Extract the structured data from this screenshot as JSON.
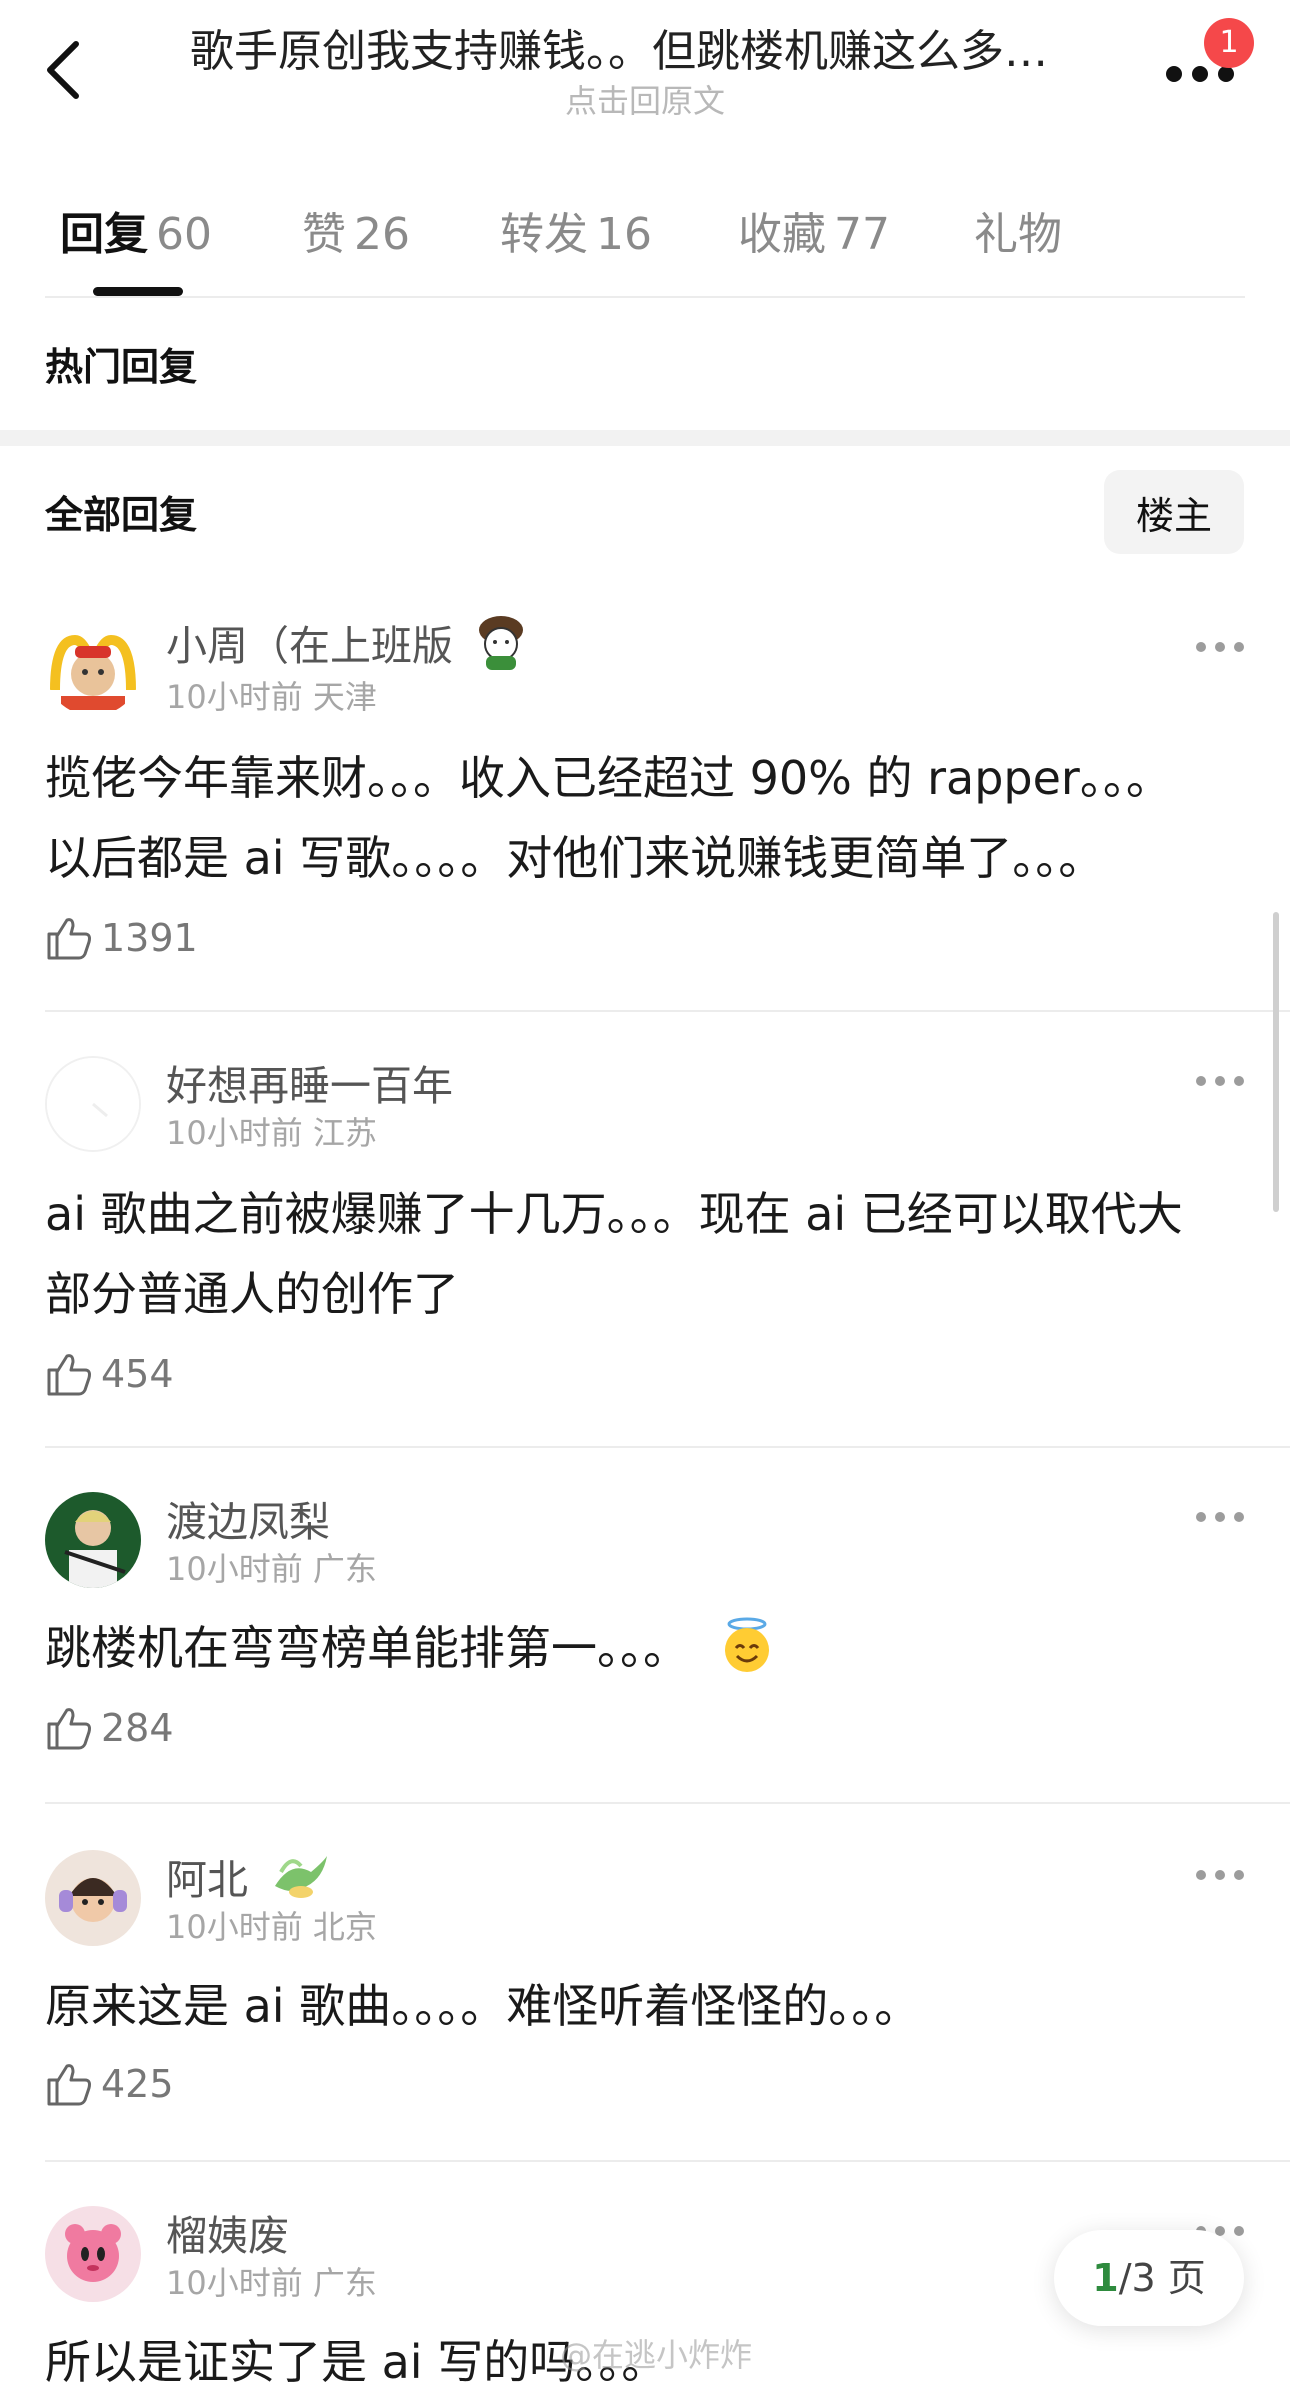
{
  "header": {
    "title": "歌手原创我支持赚钱。。但跳楼机赚这么多…",
    "subtitle": "点击回原文",
    "notification_count": "1"
  },
  "tabs": [
    {
      "label": "回复",
      "count": "60"
    },
    {
      "label": "赞",
      "count": "26"
    },
    {
      "label": "转发",
      "count": "16"
    },
    {
      "label": "收藏",
      "count": "77"
    },
    {
      "label": "礼物",
      "count": ""
    }
  ],
  "sections": {
    "hot_title": "热门回复",
    "all_title": "全部回复",
    "op_filter": "楼主"
  },
  "comments": [
    {
      "user": "小周（在上班版",
      "time": "10小时前",
      "location": "天津",
      "lines": [
        "揽佬今年靠来财。。。收入已经超过 90% 的 rapper。。。",
        "以后都是 ai 写歌。。。。对他们来说赚钱更简单了。。。"
      ],
      "likes": "1391"
    },
    {
      "user": "好想再睡一百年",
      "time": "10小时前",
      "location": "江苏",
      "lines": [
        "ai 歌曲之前被爆赚了十几万。。。现在 ai 已经可以取代大",
        "部分普通人的创作了"
      ],
      "likes": "454"
    },
    {
      "user": "渡边凤梨",
      "time": "10小时前",
      "location": "广东",
      "lines": [
        "跳楼机在弯弯榜单能排第一。。。"
      ],
      "emoji": "😇",
      "likes": "284"
    },
    {
      "user": "阿北",
      "time": "10小时前",
      "location": "北京",
      "lines": [
        "原来这是 ai 歌曲。。。。难怪听着怪怪的。。。"
      ],
      "likes": "425"
    },
    {
      "user": "榴姨废",
      "time": "10小时前",
      "location": "广东",
      "lines": [
        "所以是证实了是 ai 写的吗。。。"
      ],
      "likes": ""
    }
  ],
  "pager": {
    "current": "1",
    "total_text": "/3 页"
  },
  "watermark": "@在逃小炸炸",
  "colors": {
    "badge": "#f5484a",
    "pager_current": "#2e8b3e",
    "band": "#f2f2f2"
  }
}
